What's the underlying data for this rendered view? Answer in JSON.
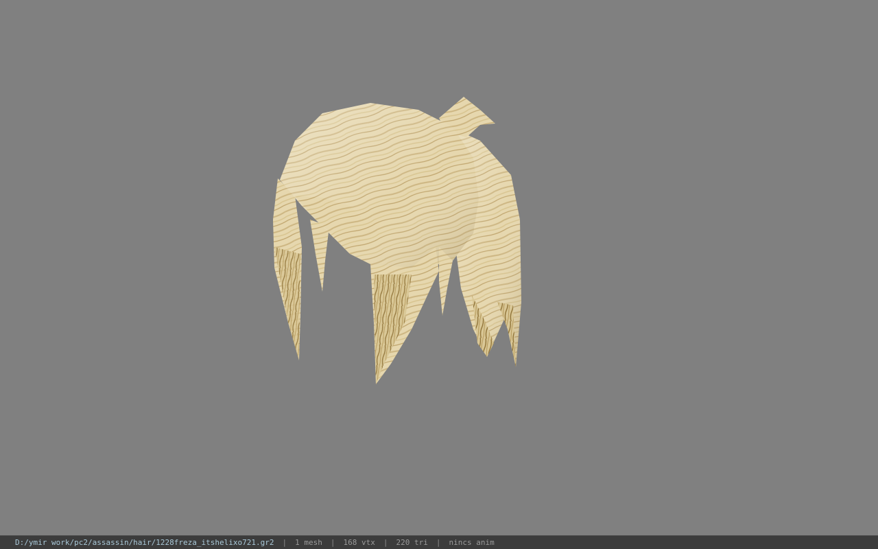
{
  "viewer": {
    "background_color": "#808080",
    "model": {
      "icon": "hair-mesh-model",
      "colors": {
        "base": "#e6d7ae",
        "light": "#f3e9c9",
        "mid": "#cdb682",
        "dark": "#8f7236",
        "shadow": "#a88e55"
      }
    }
  },
  "status_bar": {
    "file_path": "D:/ymir work/pc2/assassin/hair/1228freza_itshelixo721.gr2",
    "separator": "|",
    "mesh_count": "1 mesh",
    "vertex_count": "168 vtx",
    "triangle_count": "220 tri",
    "anim_status": "nincs anim"
  }
}
